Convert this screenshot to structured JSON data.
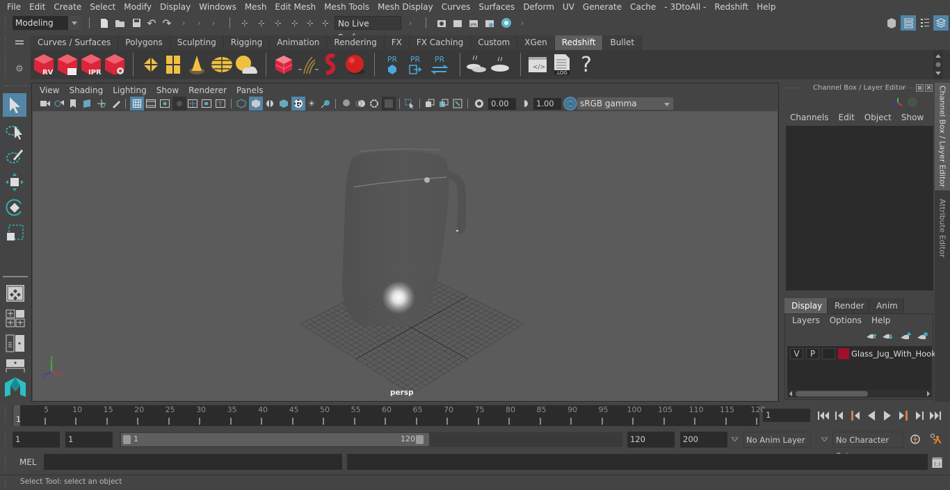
{
  "menubar": {
    "items": [
      "File",
      "Edit",
      "Create",
      "Select",
      "Modify",
      "Display",
      "Windows",
      "Mesh",
      "Edit Mesh",
      "Mesh Tools",
      "Mesh Display",
      "Curves",
      "Surfaces",
      "Deform",
      "UV",
      "Generate",
      "Cache",
      "- 3DtoAll -",
      "Redshift",
      "Help"
    ]
  },
  "statusline": {
    "workspace_selector": "Modeling",
    "live_surface": "No Live Surface"
  },
  "shelf": {
    "tabs": [
      "Curves / Surfaces",
      "Polygons",
      "Sculpting",
      "Rigging",
      "Animation",
      "Rendering",
      "FX",
      "FX Caching",
      "Custom",
      "XGen",
      "Redshift",
      "Bullet"
    ],
    "active_tab": "Redshift",
    "buttons": [
      {
        "icon": "redshift-renderview-icon",
        "label": "RV"
      },
      {
        "icon": "redshift-batch-render-icon",
        "label": ""
      },
      {
        "icon": "redshift-ipr-icon",
        "label": "IPR"
      },
      {
        "icon": "redshift-settings-icon",
        "label": ""
      },
      {
        "icon": "area-light-icon",
        "label": ""
      },
      {
        "icon": "portal-light-icon",
        "label": ""
      },
      {
        "icon": "ies-light-icon",
        "label": ""
      },
      {
        "icon": "dome-light-icon",
        "label": ""
      },
      {
        "icon": "sun-sky-icon",
        "label": ""
      },
      {
        "icon": "proxy-cube-icon",
        "label": ""
      },
      {
        "icon": "hair-icon",
        "label": ""
      },
      {
        "icon": "volume-icon",
        "label": ""
      },
      {
        "icon": "material-ball-icon",
        "label": ""
      },
      {
        "icon": "proxy-export-icon",
        "label": "PR"
      },
      {
        "icon": "proxy-import-icon",
        "label": "PR"
      },
      {
        "icon": "proxy-convert-icon",
        "label": "PR"
      },
      {
        "icon": "bake-icon",
        "label": ""
      },
      {
        "icon": "bake-single-icon",
        "label": ""
      },
      {
        "icon": "script-icon",
        "label": ""
      },
      {
        "icon": "log-icon",
        "label": ".LOG"
      },
      {
        "icon": "help-icon",
        "label": "?"
      }
    ]
  },
  "viewport": {
    "menu": [
      "View",
      "Shading",
      "Lighting",
      "Show",
      "Renderer",
      "Panels"
    ],
    "exposure": "0.00",
    "gamma": "1.00",
    "color_space": "sRGB gamma",
    "camera_label": "persp",
    "axis": {
      "x": "x",
      "y": "y",
      "z": "z"
    }
  },
  "channel_box": {
    "title": "Channel Box / Layer Editor",
    "menu": [
      "Channels",
      "Edit",
      "Object",
      "Show"
    ]
  },
  "layer_editor": {
    "tabs": [
      "Display",
      "Render",
      "Anim"
    ],
    "active_tab": "Display",
    "menu": [
      "Layers",
      "Options",
      "Help"
    ],
    "layers": [
      {
        "visible": "V",
        "playback": "P",
        "type": "",
        "color": "#a0102a",
        "name": "Glass_Jug_With_Hook"
      }
    ]
  },
  "side_tabs": [
    "Channel Box / Layer Editor",
    "Attribute Editor"
  ],
  "timeline": {
    "start_marker": "1",
    "ticks": [
      5,
      10,
      15,
      20,
      25,
      30,
      35,
      40,
      45,
      50,
      55,
      60,
      65,
      70,
      75,
      80,
      85,
      90,
      95,
      100,
      105,
      110,
      115,
      120
    ],
    "current_frame": "1",
    "playback_controls": [
      "go-to-start",
      "step-back-key",
      "prev-key",
      "play-backward",
      "play-forward",
      "next-key",
      "step-forward-key",
      "go-to-end"
    ]
  },
  "range": {
    "start_time": "1",
    "playback_start": "1",
    "slider_start": "1",
    "slider_end": "120",
    "playback_end": "120",
    "end_time": "200",
    "anim_layer": "No Anim Layer",
    "character_set": "No Character Set"
  },
  "command_line": {
    "label": "MEL",
    "input": "",
    "output": ""
  },
  "help_line": {
    "text": "Select Tool: select an object"
  },
  "colors": {
    "accent": "#5285a6",
    "layer_color": "#a0102a",
    "redshift_red": "#d9263a",
    "light_yellow": "#f0c040"
  }
}
